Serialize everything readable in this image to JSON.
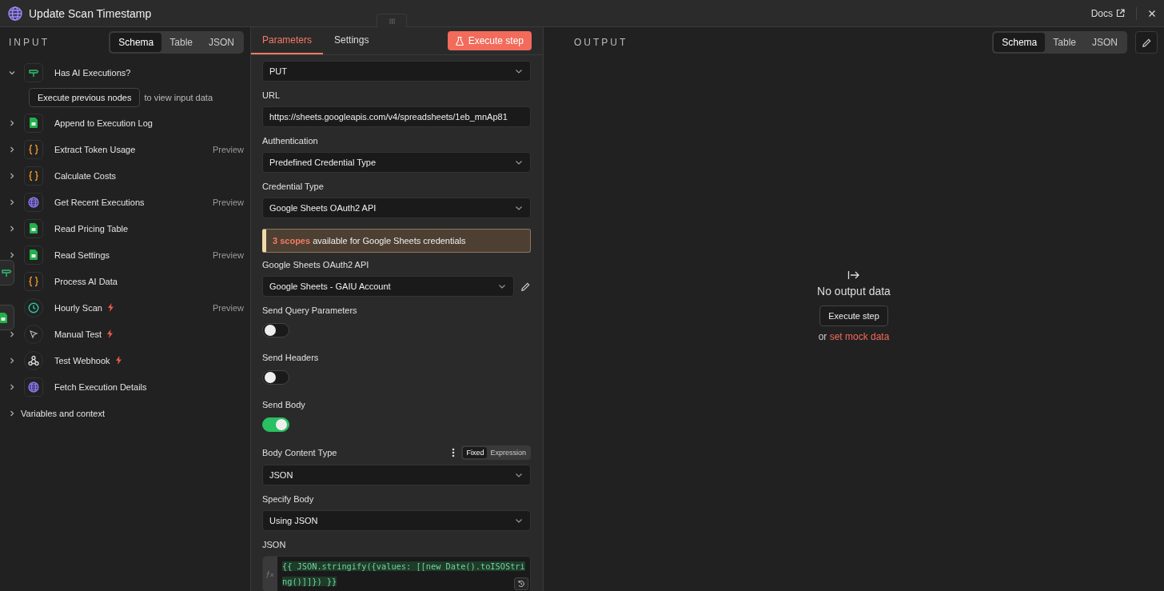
{
  "window": {
    "title": "Update Scan Timestamp",
    "docs": "Docs"
  },
  "input": {
    "title": "INPUT",
    "views": [
      {
        "label": "Schema",
        "selected": true
      },
      {
        "label": "Table",
        "selected": false
      },
      {
        "label": "JSON",
        "selected": false
      }
    ],
    "nodes": [
      {
        "name": "Has AI Executions?",
        "kind": "if",
        "expanded": true,
        "trigger": false,
        "action": "Execute previous nodes",
        "hint": "to view input data"
      },
      {
        "name": "Append to Execution Log",
        "kind": "sheets",
        "expanded": false,
        "trigger": false
      },
      {
        "name": "Extract Token Usage",
        "kind": "code",
        "expanded": false,
        "trigger": false,
        "preview": "Preview"
      },
      {
        "name": "Calculate Costs",
        "kind": "code",
        "expanded": false,
        "trigger": false
      },
      {
        "name": "Get Recent Executions",
        "kind": "globe",
        "expanded": false,
        "trigger": false,
        "preview": "Preview"
      },
      {
        "name": "Read Pricing Table",
        "kind": "sheets",
        "expanded": false,
        "trigger": false
      },
      {
        "name": "Read Settings",
        "kind": "sheets",
        "expanded": false,
        "trigger": false,
        "preview": "Preview"
      },
      {
        "name": "Process AI Data",
        "kind": "code",
        "expanded": false,
        "trigger": false
      },
      {
        "name": "Hourly Scan",
        "kind": "clock",
        "expanded": false,
        "trigger": true,
        "preview": "Preview"
      },
      {
        "name": "Manual Test",
        "kind": "cursor",
        "expanded": false,
        "trigger": true
      },
      {
        "name": "Test Webhook",
        "kind": "webhook",
        "expanded": false,
        "trigger": true
      },
      {
        "name": "Fetch Execution Details",
        "kind": "globe",
        "expanded": false,
        "trigger": false
      }
    ],
    "variables": "Variables and context"
  },
  "parameters": {
    "tabs": [
      {
        "label": "Parameters",
        "selected": true
      },
      {
        "label": "Settings",
        "selected": false
      }
    ],
    "execute": "Execute step",
    "fields": [
      {
        "kind": "select",
        "value": "PUT"
      },
      {
        "kind": "input",
        "label": "URL",
        "value": "https://sheets.googleapis.com/v4/spreadsheets/1eb_mnAp81"
      },
      {
        "kind": "select",
        "label": "Authentication",
        "value": "Predefined Credential Type"
      },
      {
        "kind": "select",
        "label": "Credential Type",
        "value": "Google Sheets OAuth2 API"
      },
      {
        "kind": "notice",
        "highlight": "3 scopes",
        "text": "available for Google Sheets credentials"
      },
      {
        "kind": "credential",
        "label": "Google Sheets OAuth2 API",
        "value": "Google Sheets - GAIU Account"
      },
      {
        "kind": "toggle",
        "label": "Send Query Parameters",
        "on": false
      },
      {
        "kind": "toggle",
        "label": "Send Headers",
        "on": false
      },
      {
        "kind": "toggle",
        "label": "Send Body",
        "on": true
      },
      {
        "kind": "select",
        "label": "Body Content Type",
        "value": "JSON",
        "modes": [
          {
            "label": "Fixed",
            "selected": true
          },
          {
            "label": "Expression",
            "selected": false
          }
        ]
      },
      {
        "kind": "select",
        "label": "Specify Body",
        "value": "Using JSON"
      },
      {
        "kind": "code",
        "label": "JSON",
        "value": "{{ JSON.stringify({values: [[new Date().toISOString()]]}) }}"
      }
    ]
  },
  "output": {
    "title": "OUTPUT",
    "views": [
      {
        "label": "Schema",
        "selected": true
      },
      {
        "label": "Table",
        "selected": false
      },
      {
        "label": "JSON",
        "selected": false
      }
    ],
    "empty": {
      "title": "No output data",
      "action": "Execute step",
      "prefix": "or",
      "link": "set mock data"
    }
  }
}
